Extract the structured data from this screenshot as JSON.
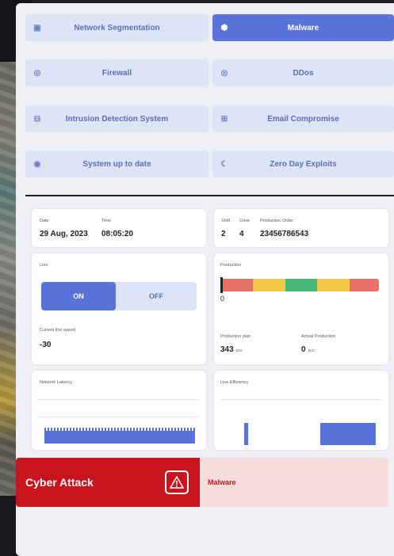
{
  "threats": [
    {
      "label": "Network Segmentation",
      "icon": "grid-icon",
      "active": false
    },
    {
      "label": "Malware",
      "icon": "bug-icon",
      "active": true
    },
    {
      "label": "Firewall",
      "icon": "shield-icon",
      "active": false
    },
    {
      "label": "DDos",
      "icon": "target-icon",
      "active": false
    },
    {
      "label": "Intrusion Detection System",
      "icon": "server-icon",
      "active": false
    },
    {
      "label": "Email Compromise",
      "icon": "mail-icon",
      "active": false
    },
    {
      "label": "System up to date",
      "icon": "refresh-icon",
      "active": false
    },
    {
      "label": "Zero Day Exploits",
      "icon": "moon-icon",
      "active": false
    }
  ],
  "datetime": {
    "date_label": "Date",
    "date_value": "29 Aug, 2023",
    "time_label": "Time",
    "time_value": "08:05:20"
  },
  "shift": {
    "shift_label": "Shift",
    "shift_value": "2",
    "crew_label": "Crew",
    "crew_value": "4",
    "order_label": "Production Order",
    "order_value": "23456786543"
  },
  "line": {
    "label": "Line",
    "on_label": "ON",
    "off_label": "OFF",
    "state": "ON",
    "speed_label": "Current line speed",
    "speed_value": "-30"
  },
  "production": {
    "label": "Production",
    "bar_value": "0",
    "segments": [
      "#e8716a",
      "#f2c84a",
      "#4ab878",
      "#f2c84a",
      "#e8716a"
    ],
    "plan_label": "Production plan",
    "plan_value": "343",
    "plan_unit": "pcs",
    "actual_label": "Actual Production",
    "actual_value": "0",
    "actual_unit": "pcs"
  },
  "latency": {
    "label": "Network Latency"
  },
  "efficiency": {
    "label": "Line Efficiency"
  },
  "alert": {
    "title": "Cyber Attack",
    "threat": "Malware",
    "color": "#c8141c"
  },
  "accent": "#5a73db"
}
